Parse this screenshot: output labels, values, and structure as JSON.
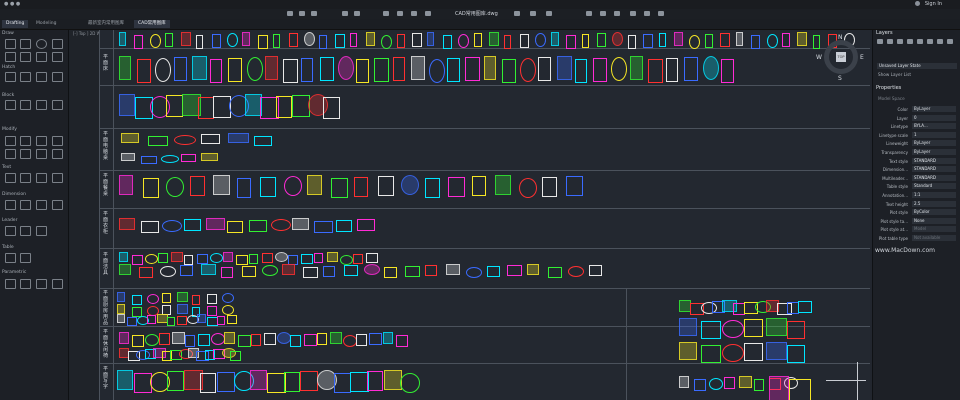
{
  "window": {
    "title": "CAD常用图库.dwg",
    "signin": "Sign In"
  },
  "tabs": {
    "workspace": [
      "Drafting",
      "Modeling"
    ],
    "documents": [
      "最新室内常用图库",
      "CAD常用图库"
    ]
  },
  "left_panel": {
    "sections": [
      "Draw",
      "Modify",
      "Text",
      "Dimension",
      "Leader",
      "Table",
      "Parametric"
    ],
    "sub": [
      "Hatch",
      "Block"
    ]
  },
  "canvas": {
    "breadcrumb": "[-] Top ] 2D Wireframe",
    "row_labels": [
      "平\n面\n床",
      "平\n面\n电\n脑\n桌",
      "平\n面\n餐\n桌",
      "平\n面\n衣\n柜",
      "平\n面\n洁\n具",
      "平\n面\n厨\n房\n用\n品",
      "平\n面\n休\n闲\n椅",
      "平\n面\n写\n字"
    ],
    "compass": {
      "top": "TOP",
      "n": "N",
      "s": "S",
      "w": "W",
      "e": "E"
    }
  },
  "watermark": "www.MacDown.com",
  "right_panel": {
    "layers_title": "Layers",
    "layer_state": "Unsaved Layer State",
    "show_layer_list": "Show Layer List",
    "properties_title": "Properties",
    "model_space": "Model Space",
    "props": [
      {
        "k": "Color",
        "v": "ByLayer",
        "dim": false
      },
      {
        "k": "Layer",
        "v": "0",
        "dim": false
      },
      {
        "k": "Linetype",
        "v": "BYLA...",
        "dim": false
      },
      {
        "k": "Linetype scale",
        "v": "1",
        "dim": false
      },
      {
        "k": "Lineweight",
        "v": "ByLayer",
        "dim": false
      },
      {
        "k": "Transparency",
        "v": "ByLayer",
        "dim": false
      },
      {
        "k": "Text style",
        "v": "STANDARD",
        "dim": false
      },
      {
        "k": "Dimension...",
        "v": "STANDARD",
        "dim": false
      },
      {
        "k": "Multileader...",
        "v": "STANDARD",
        "dim": false
      },
      {
        "k": "Table style",
        "v": "Standard",
        "dim": false
      },
      {
        "k": "Annotation...",
        "v": "1:1",
        "dim": false
      },
      {
        "k": "Text height",
        "v": "2.5",
        "dim": false
      },
      {
        "k": "Plot style",
        "v": "ByColor",
        "dim": false
      },
      {
        "k": "Plot style ta...",
        "v": "None",
        "dim": false
      },
      {
        "k": "Plot style at...",
        "v": "Model",
        "dim": true
      },
      {
        "k": "Plot table type",
        "v": "Not available",
        "dim": true
      }
    ]
  },
  "colors": {
    "cyan": "#00e5ff",
    "magenta": "#ff2bd6",
    "yellow": "#f5e625",
    "green": "#32f032",
    "red": "#ff3030",
    "white": "#e8e8e8",
    "blue": "#3a6bff"
  }
}
